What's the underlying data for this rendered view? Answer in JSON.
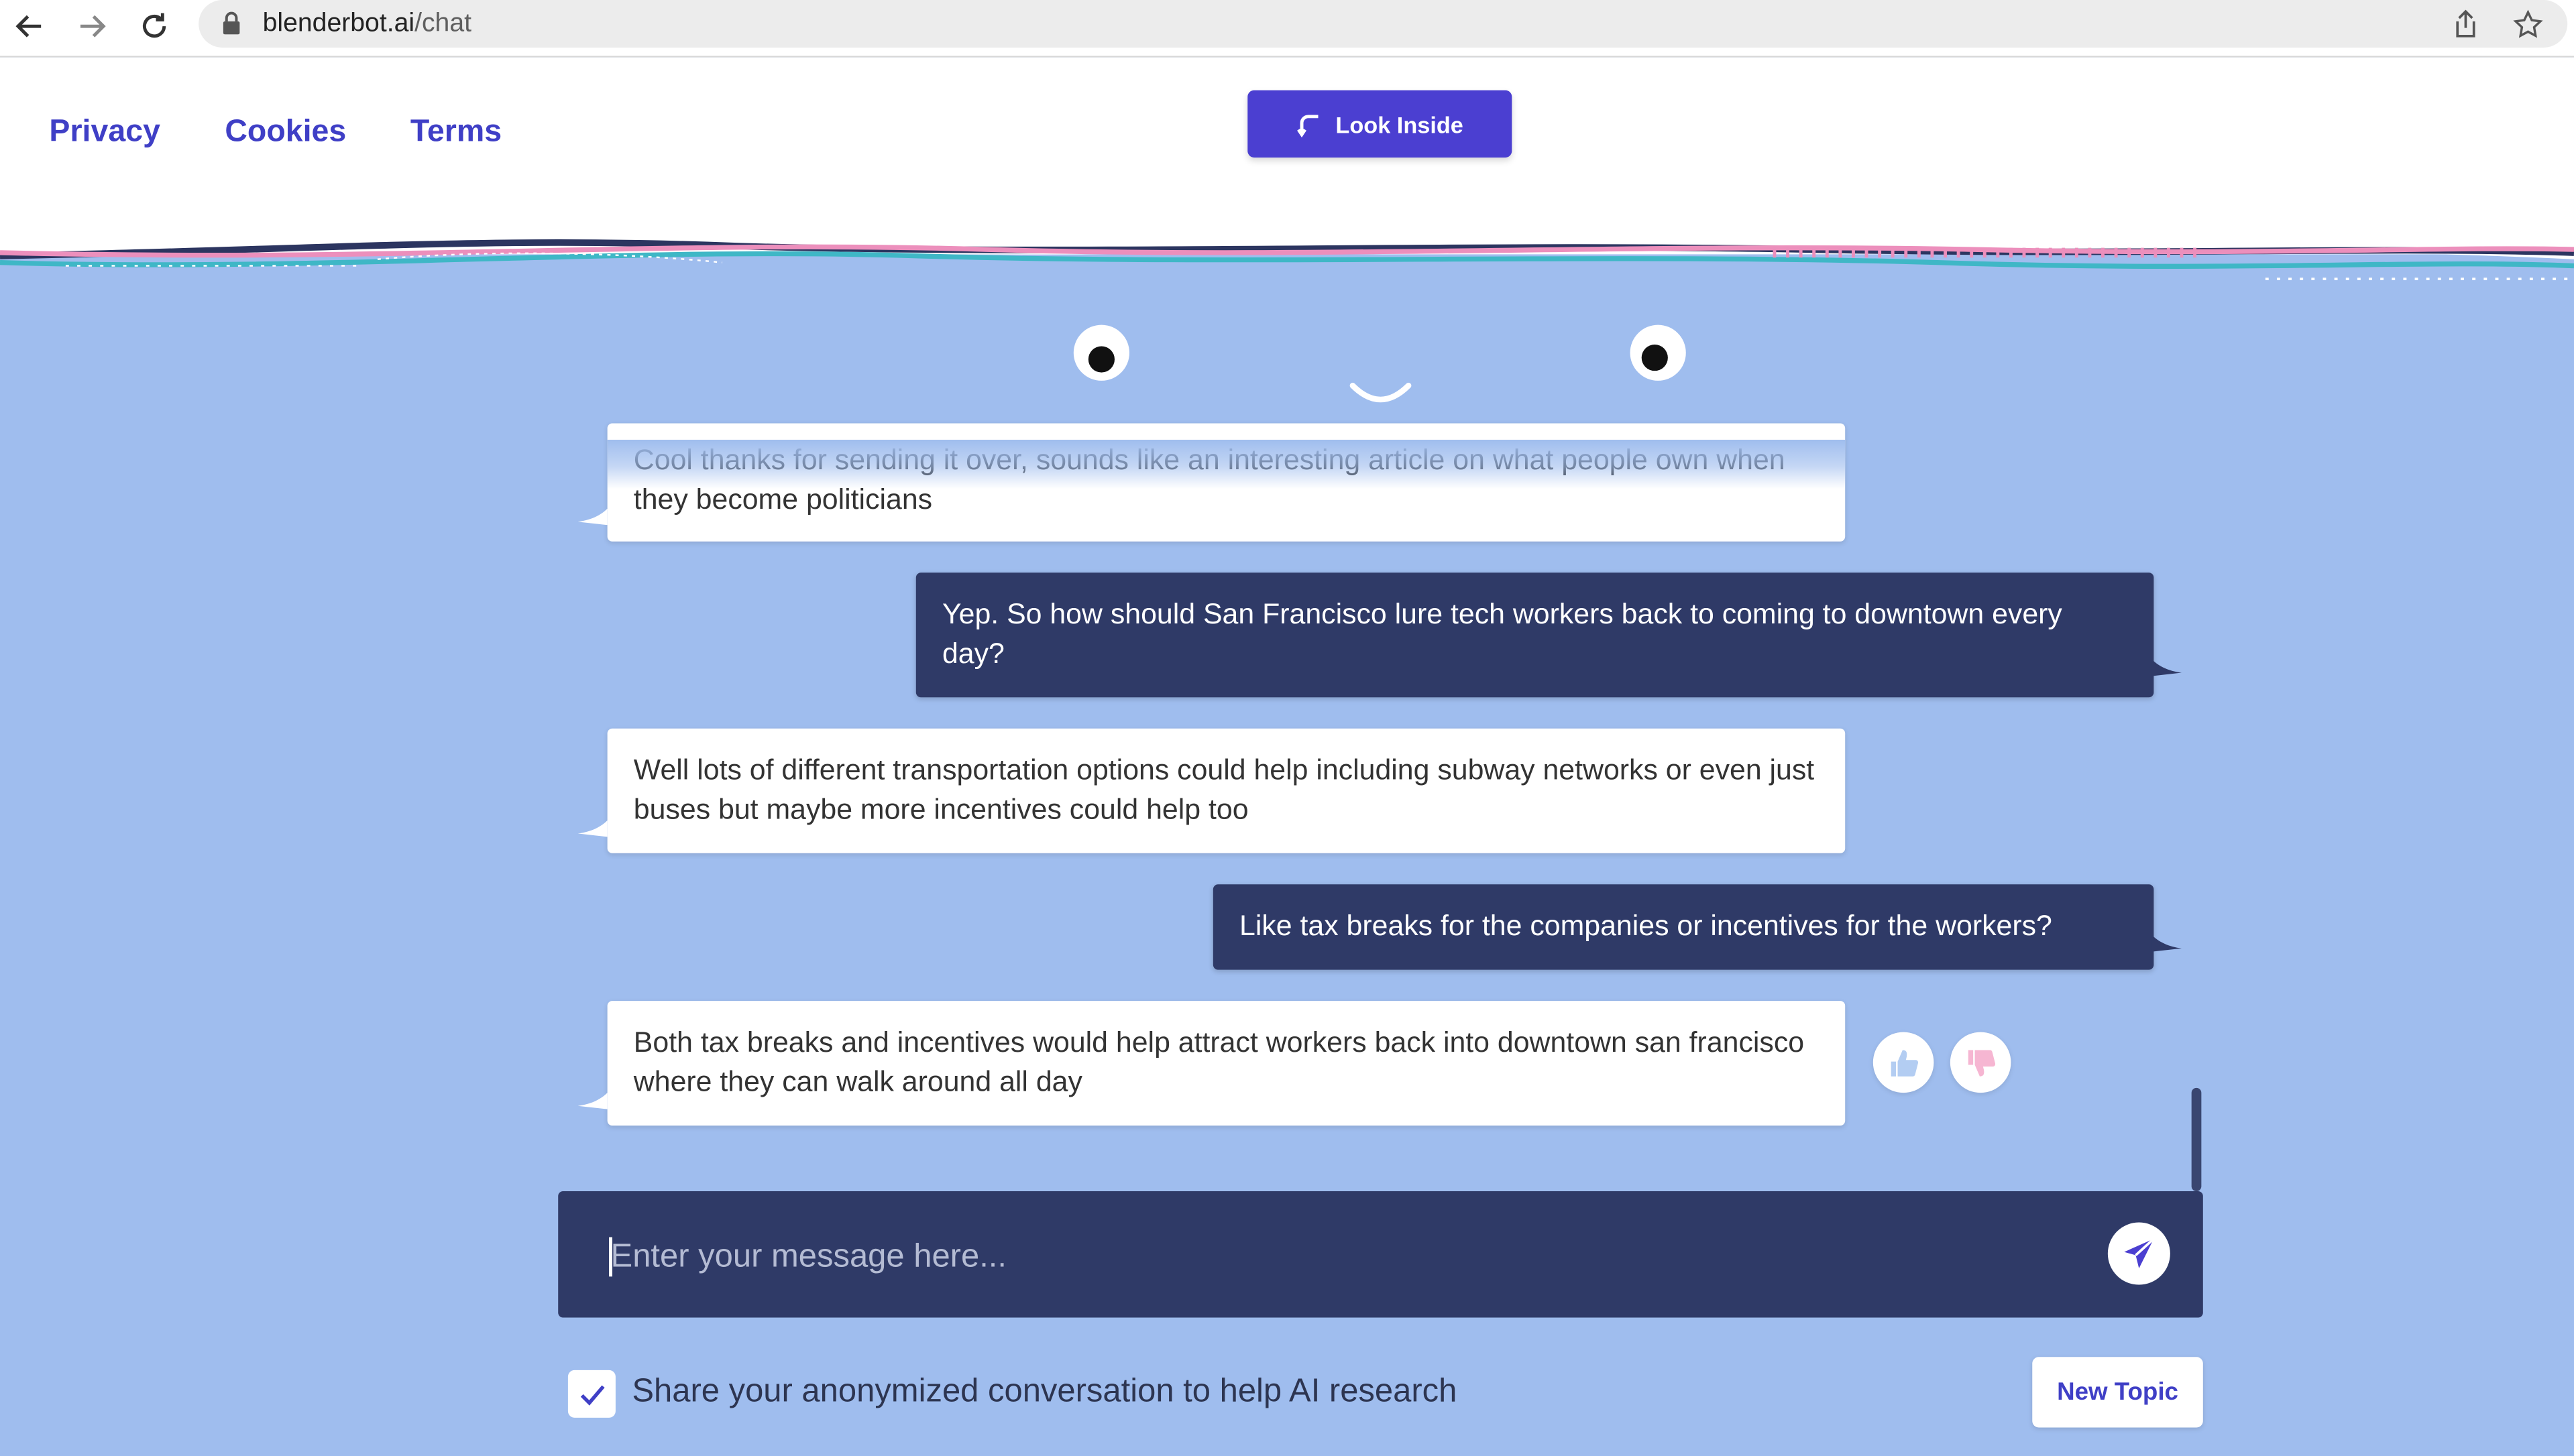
{
  "browser": {
    "url_domain": "blenderbot.ai",
    "url_path": "/chat",
    "icons": [
      "back-arrow-icon",
      "forward-arrow-icon",
      "reload-icon",
      "lock-icon",
      "share-icon",
      "star-icon"
    ]
  },
  "nav": {
    "privacy": "Privacy",
    "cookies": "Cookies",
    "terms": "Terms",
    "look_inside": "Look Inside"
  },
  "chat": {
    "messages": [
      {
        "from": "bot",
        "text": "Cool thanks for sending it over, sounds like an interesting article on what people own when they become politicians"
      },
      {
        "from": "user",
        "text": "Yep. So how should San Francisco lure tech workers back to coming to downtown every day?"
      },
      {
        "from": "bot",
        "text": "Well lots of different transportation options could help including subway networks or even just buses but maybe more incentives could help too"
      },
      {
        "from": "user",
        "text": "Like tax breaks for the companies or incentives for the workers?"
      },
      {
        "from": "bot",
        "text": "Both tax breaks and incentives would help attract workers back into downtown san francisco where they can walk around all day"
      }
    ]
  },
  "composer": {
    "placeholder": "Enter your message here...",
    "share_label": "Share your anonymized conversation to help AI research",
    "share_checked": true,
    "new_topic": "New Topic"
  },
  "colors": {
    "background": "#9fbdee",
    "user_bubble": "#2f3a67",
    "accent": "#4b3fd1",
    "link": "#3f3fc6"
  }
}
